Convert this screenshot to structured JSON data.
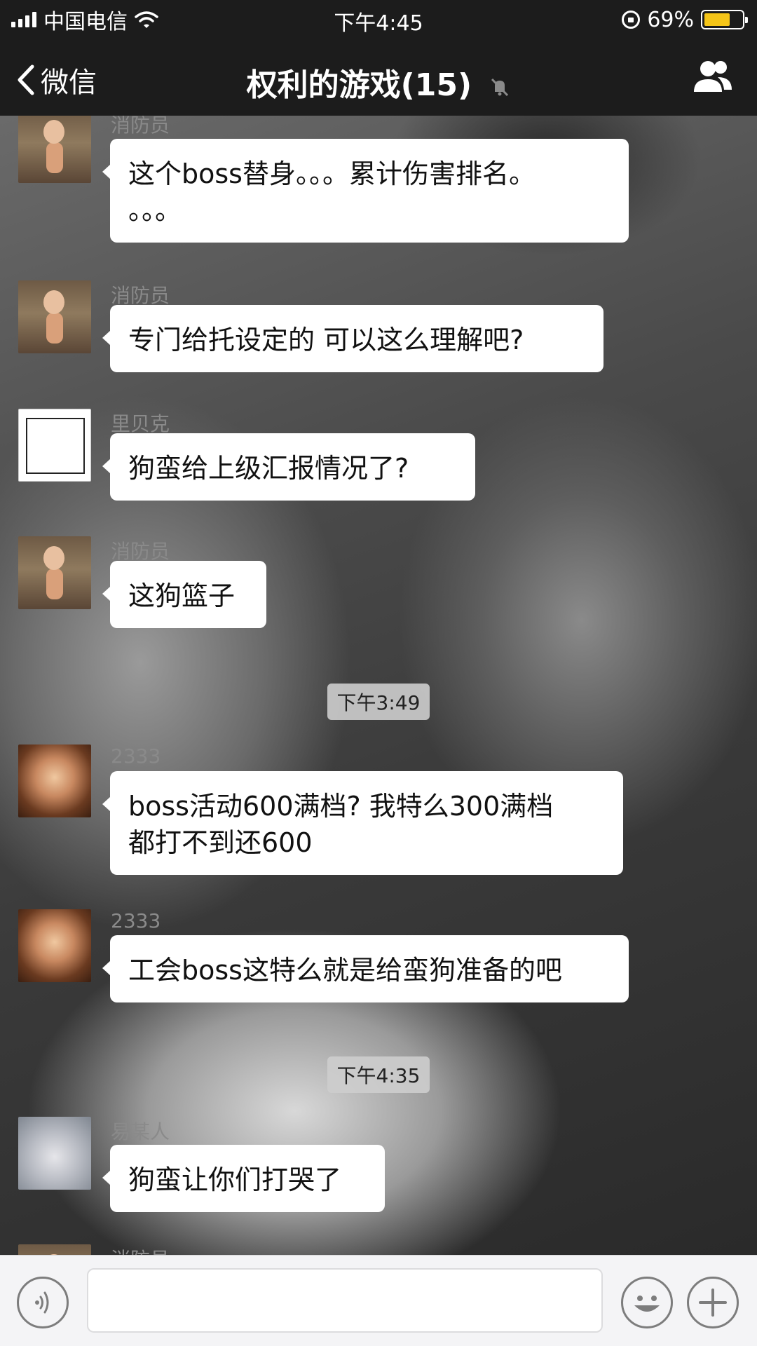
{
  "status_bar": {
    "carrier": "中国电信",
    "time": "下午4:45",
    "battery_percent": "69%",
    "battery_level": 0.69,
    "icons": [
      "signal-icon",
      "wifi-icon",
      "rotation-lock-icon",
      "battery-icon"
    ]
  },
  "nav": {
    "back_label": "微信",
    "title": "权利的游戏(15)",
    "icons": [
      "back-chevron-icon",
      "mute-icon",
      "group-members-icon"
    ]
  },
  "messages": [
    {
      "sender": "消防员",
      "text_lines": [
        "这个boss替身。。。累计伤害排名。",
        "。。。"
      ],
      "avatar": "baby-avatar"
    },
    {
      "sender": "消防员",
      "text_lines": [
        "专门给托设定的 可以这么理解吧?"
      ],
      "avatar": "baby-avatar"
    },
    {
      "sender": "里贝克",
      "text_lines": [
        "狗蛮给上级汇报情况了?"
      ],
      "avatar": "sketch-avatar"
    },
    {
      "sender": "消防员",
      "text_lines": [
        "这狗篮子"
      ],
      "avatar": "baby-avatar"
    },
    {
      "sender": "2333",
      "text_lines": [
        "boss活动600满档?  我特么300满档",
        "都打不到还600"
      ],
      "avatar": "toddler-avatar"
    },
    {
      "sender": "2333",
      "text_lines": [
        "工会boss这特么就是给蛮狗准备的吧"
      ],
      "avatar": "toddler-avatar"
    },
    {
      "sender": "易某人",
      "text_lines": [
        "狗蛮让你们打哭了"
      ],
      "avatar": "cat-avatar"
    },
    {
      "sender": "消防员",
      "text_lines": [],
      "avatar": "baby-avatar"
    }
  ],
  "timestamps": [
    "下午3:49",
    "下午4:35"
  ],
  "input_bar": {
    "placeholder": "",
    "icons": [
      "voice-icon",
      "emoji-icon",
      "plus-icon"
    ]
  }
}
